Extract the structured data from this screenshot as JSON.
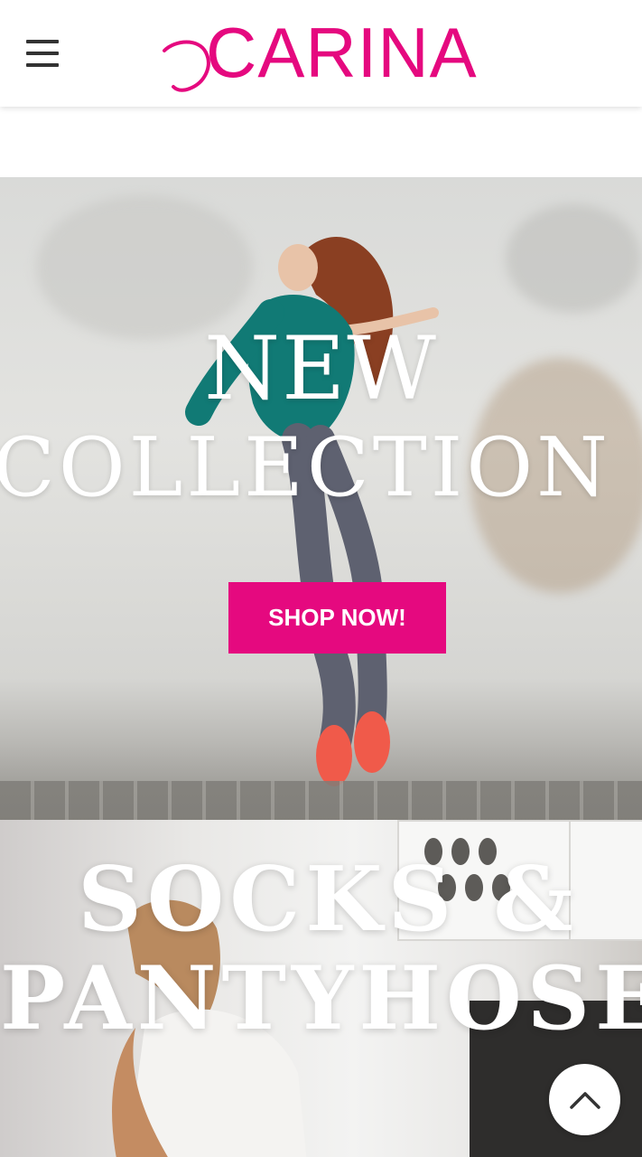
{
  "header": {
    "logo_text": "CARINA",
    "menu_icon": "hamburger-menu-icon"
  },
  "hero": {
    "title_line1": "NEW",
    "title_line2": "COLLECTION",
    "cta_label": "SHOP NOW!"
  },
  "category": {
    "title_line1": "SOCKS &",
    "title_line2": "PANTYHOSE"
  },
  "scroll_top": {
    "icon": "chevron-up-icon"
  },
  "colors": {
    "brand": "#e5097f",
    "hero_text": "#ffffff"
  }
}
